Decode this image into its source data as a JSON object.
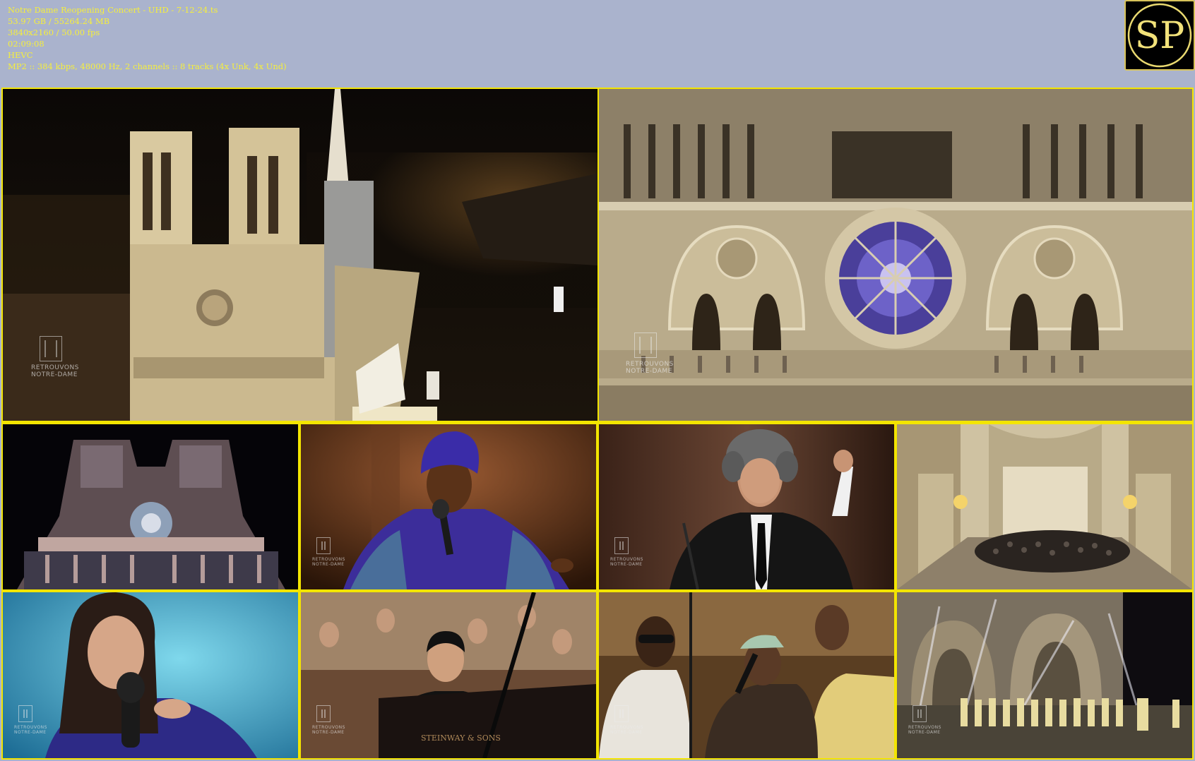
{
  "info": {
    "filename": "Notre Dame Reopening Concert - UHD - 7-12-24.ts",
    "size": "53.97 GB / 55264.24 MB",
    "resolution": "3840x2160 / 50.00 fps",
    "duration": "02:09:08",
    "video_codec": "HEVC",
    "audio": "MP2 :: 384 kbps, 48000 Hz, 2 channels :: 8 tracks (4x Unk, 4x Und)"
  },
  "logo": {
    "text": "SP"
  },
  "colors": {
    "background": "#aab3cd",
    "info_text": "#f6ef3c",
    "border": "#f3e500"
  },
  "watermark": {
    "line1": "RETROUVONS",
    "line2": "NOTRE-DAME"
  },
  "piano_brand": "STEINWAY & SONS",
  "thumbnails": [
    {
      "name": "notre-dame-aerial-night"
    },
    {
      "name": "notre-dame-facade-rose-window"
    },
    {
      "name": "cathedral-projection-mapping"
    },
    {
      "name": "singer-blue-headwrap"
    },
    {
      "name": "conductor"
    },
    {
      "name": "orchestra-in-nave"
    },
    {
      "name": "singer-microphone-closeup"
    },
    {
      "name": "pianist-with-orchestra"
    },
    {
      "name": "gospel-choir-singer-cap"
    },
    {
      "name": "choir-on-forecourt"
    }
  ]
}
